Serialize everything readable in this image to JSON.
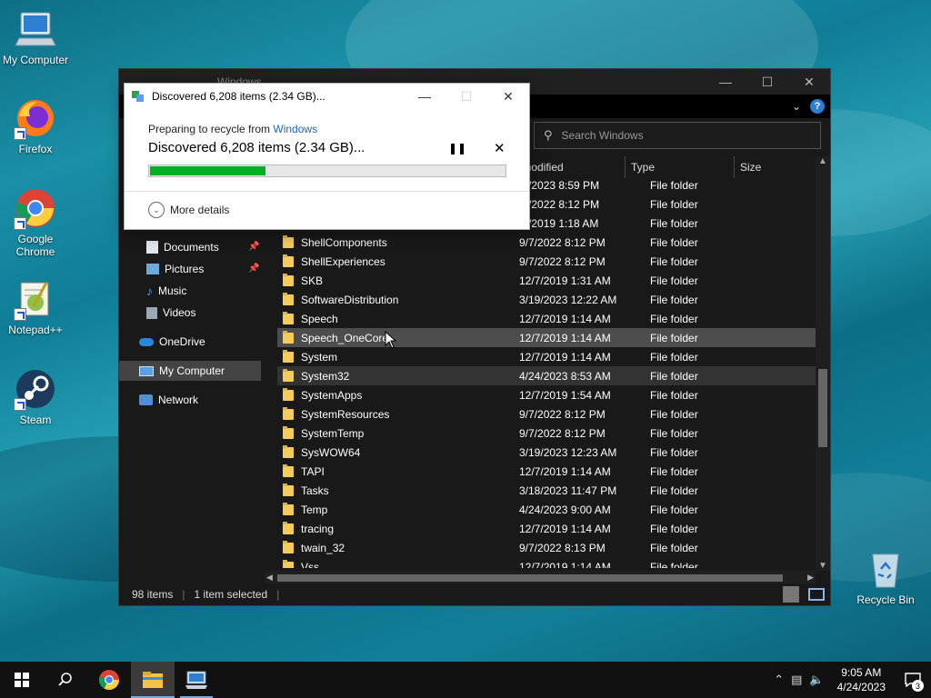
{
  "desktop": {
    "icons": [
      {
        "label": "My Computer"
      },
      {
        "label": "Firefox"
      },
      {
        "label": "Google Chrome"
      },
      {
        "label": "Notepad++"
      },
      {
        "label": "Steam"
      },
      {
        "label": "Recycle Bin"
      }
    ]
  },
  "explorer": {
    "title": "Windows",
    "search_placeholder": "Search Windows",
    "columns": [
      "te modified",
      "Type",
      "Size"
    ],
    "nav": [
      {
        "label": "Documents"
      },
      {
        "label": "Pictures"
      },
      {
        "label": "Music"
      },
      {
        "label": "Videos"
      },
      {
        "label": "OneDrive"
      },
      {
        "label": "My Computer"
      },
      {
        "label": "Network"
      }
    ],
    "rows": [
      {
        "name": "",
        "date": "/8/2023 8:59 PM",
        "type": "File folder"
      },
      {
        "name": "",
        "date": "/7/2022 8:12 PM",
        "type": "File folder"
      },
      {
        "name": "",
        "date": "/7/2019 1:18 AM",
        "type": "File folder"
      },
      {
        "name": "ShellComponents",
        "date": "9/7/2022 8:12 PM",
        "type": "File folder"
      },
      {
        "name": "ShellExperiences",
        "date": "9/7/2022 8:12 PM",
        "type": "File folder"
      },
      {
        "name": "SKB",
        "date": "12/7/2019 1:31 AM",
        "type": "File folder"
      },
      {
        "name": "SoftwareDistribution",
        "date": "3/19/2023 12:22 AM",
        "type": "File folder"
      },
      {
        "name": "Speech",
        "date": "12/7/2019 1:14 AM",
        "type": "File folder"
      },
      {
        "name": "Speech_OneCore",
        "date": "12/7/2019 1:14 AM",
        "type": "File folder"
      },
      {
        "name": "System",
        "date": "12/7/2019 1:14 AM",
        "type": "File folder"
      },
      {
        "name": "System32",
        "date": "4/24/2023 8:53 AM",
        "type": "File folder"
      },
      {
        "name": "SystemApps",
        "date": "12/7/2019 1:54 AM",
        "type": "File folder"
      },
      {
        "name": "SystemResources",
        "date": "9/7/2022 8:12 PM",
        "type": "File folder"
      },
      {
        "name": "SystemTemp",
        "date": "9/7/2022 8:12 PM",
        "type": "File folder"
      },
      {
        "name": "SysWOW64",
        "date": "3/19/2023 12:23 AM",
        "type": "File folder"
      },
      {
        "name": "TAPI",
        "date": "12/7/2019 1:14 AM",
        "type": "File folder"
      },
      {
        "name": "Tasks",
        "date": "3/18/2023 11:47 PM",
        "type": "File folder"
      },
      {
        "name": "Temp",
        "date": "4/24/2023 9:00 AM",
        "type": "File folder"
      },
      {
        "name": "tracing",
        "date": "12/7/2019 1:14 AM",
        "type": "File folder"
      },
      {
        "name": "twain_32",
        "date": "9/7/2022 8:13 PM",
        "type": "File folder"
      },
      {
        "name": "Vss",
        "date": "12/7/2019 1:14 AM",
        "type": "File folder"
      }
    ],
    "status": {
      "item_count": "98 items",
      "selection": "1 item selected"
    }
  },
  "dialog": {
    "title": "Discovered 6,208 items (2.34 GB)...",
    "subtitle_prefix": "Preparing to recycle from ",
    "subtitle_link": "Windows",
    "heading": "Discovered 6,208 items (2.34 GB)...",
    "progress_fraction": 0.33,
    "more_details": "More details"
  },
  "taskbar": {
    "time": "9:05 AM",
    "date": "4/24/2023",
    "notification_count": "3"
  },
  "colors": {
    "progress_fill": "#06b025",
    "link": "#1a66c0",
    "hover_row": "#4d4d4d"
  }
}
